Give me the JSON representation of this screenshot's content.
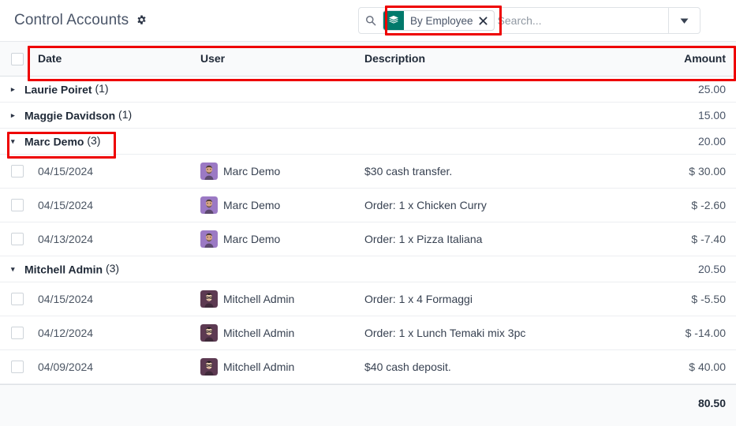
{
  "header": {
    "title": "Control Accounts",
    "gear_icon": "gear-icon"
  },
  "search": {
    "magnifier_icon": "search-icon",
    "facet": {
      "icon": "layers-stack-icon",
      "label": "By Employee",
      "close_icon": "close-icon",
      "icon_color": "#00796b"
    },
    "placeholder": "Search...",
    "value": "",
    "toggle_icon": "chevron-down-icon"
  },
  "list": {
    "columns": [
      {
        "key": "check",
        "label": ""
      },
      {
        "key": "date",
        "label": "Date"
      },
      {
        "key": "user",
        "label": "User"
      },
      {
        "key": "description",
        "label": "Description"
      },
      {
        "key": "amount",
        "label": "Amount"
      }
    ],
    "groups": [
      {
        "name": "Laurie Poiret",
        "count": "(1)",
        "amount": "25.00",
        "expanded": false,
        "caret": "▸",
        "rows": []
      },
      {
        "name": "Maggie Davidson",
        "count": "(1)",
        "amount": "15.00",
        "expanded": false,
        "caret": "▸",
        "rows": []
      },
      {
        "name": "Marc Demo",
        "count": "(3)",
        "amount": "20.00",
        "expanded": true,
        "caret": "▾",
        "rows": [
          {
            "date": "04/15/2024",
            "user": "Marc Demo",
            "avatar": "avatar-marc-demo",
            "description": "$30 cash transfer.",
            "amount": "$ 30.00"
          },
          {
            "date": "04/15/2024",
            "user": "Marc Demo",
            "avatar": "avatar-marc-demo",
            "description": "Order: 1 x Chicken Curry",
            "amount": "$ -2.60"
          },
          {
            "date": "04/13/2024",
            "user": "Marc Demo",
            "avatar": "avatar-marc-demo",
            "description": "Order: 1 x Pizza Italiana",
            "amount": "$ -7.40"
          }
        ]
      },
      {
        "name": "Mitchell Admin",
        "count": "(3)",
        "amount": "20.50",
        "expanded": true,
        "caret": "▾",
        "rows": [
          {
            "date": "04/15/2024",
            "user": "Mitchell Admin",
            "avatar": "avatar-mitchell-admin",
            "description": "Order: 1 x 4 Formaggi",
            "amount": "$ -5.50"
          },
          {
            "date": "04/12/2024",
            "user": "Mitchell Admin",
            "avatar": "avatar-mitchell-admin",
            "description": "Order: 1 x Lunch Temaki mix 3pc",
            "amount": "$ -14.00"
          },
          {
            "date": "04/09/2024",
            "user": "Mitchell Admin",
            "avatar": "avatar-mitchell-admin",
            "description": "$40 cash deposit.",
            "amount": "$ 40.00"
          }
        ]
      }
    ],
    "total": "80.50"
  },
  "annotations": [
    {
      "name": "facet-highlight",
      "color": "#ee0000"
    },
    {
      "name": "header-row-highlight",
      "color": "#ee0000"
    },
    {
      "name": "expanded-group-highlight",
      "color": "#ee0000"
    }
  ]
}
